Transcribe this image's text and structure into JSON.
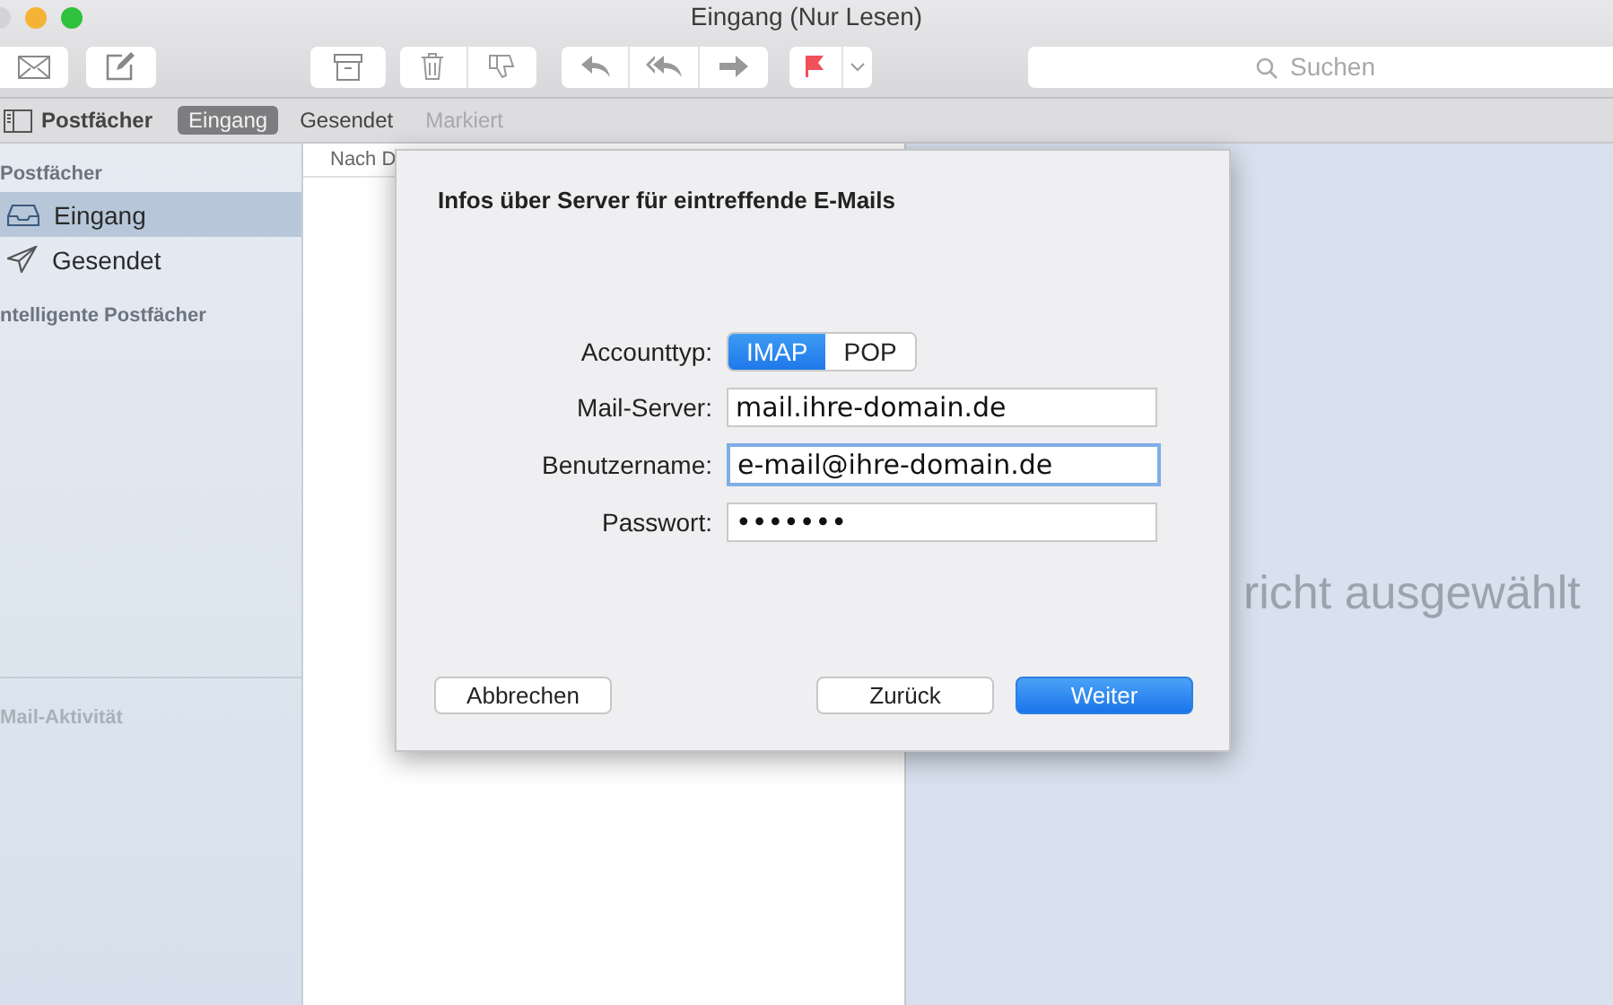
{
  "window": {
    "title": "Eingang (Nur Lesen)"
  },
  "search": {
    "placeholder": "Suchen"
  },
  "favorites_bar": {
    "mailboxes_label": "Postfächer",
    "items": [
      {
        "label": "Eingang",
        "selected": true,
        "disabled": false
      },
      {
        "label": "Gesendet",
        "selected": false,
        "disabled": false
      },
      {
        "label": "Markiert",
        "selected": false,
        "disabled": true
      }
    ]
  },
  "sidebar": {
    "sections": [
      {
        "title": "Postfächer",
        "items": [
          {
            "label": "Eingang",
            "selected": true
          },
          {
            "label": "Gesendet",
            "selected": false
          }
        ]
      },
      {
        "title": "ntelligente Postfächer"
      }
    ],
    "activity_title": "Mail-Aktivität"
  },
  "message_list": {
    "sort_label": "Nach D"
  },
  "preview": {
    "empty_text": "richt ausgewählt"
  },
  "dialog": {
    "title": "Infos über Server für eintreffende E-Mails",
    "account_type": {
      "label": "Accounttyp:",
      "options": [
        {
          "label": "IMAP",
          "selected": true
        },
        {
          "label": "POP",
          "selected": false
        }
      ]
    },
    "fields": [
      {
        "label": "Mail-Server:",
        "value": "mail.ihre-domain.de",
        "focused": false
      },
      {
        "label": "Benutzername:",
        "value": "e-mail@ihre-domain.de",
        "focused": true
      },
      {
        "label": "Passwort:",
        "value": "•••••••",
        "focused": false
      }
    ],
    "buttons": [
      {
        "label": "Abbrechen",
        "kind": "cancel"
      },
      {
        "label": "Zurück",
        "kind": "normal"
      },
      {
        "label": "Weiter",
        "kind": "default"
      }
    ]
  }
}
